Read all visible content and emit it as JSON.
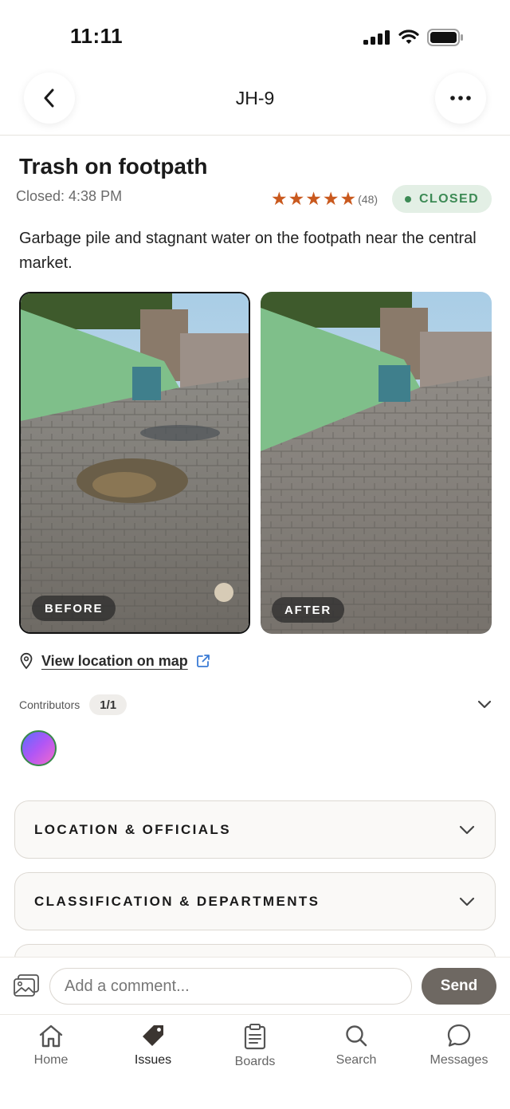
{
  "status_bar": {
    "time": "11:11"
  },
  "header": {
    "title": "JH-9",
    "back_icon": "chevron-left-icon",
    "more_icon": "ellipsis-icon"
  },
  "issue": {
    "title": "Trash on footpath",
    "closed_time": "Closed: 4:38 PM",
    "rating": {
      "stars": 5,
      "count": "(48)",
      "color": "#c9591e"
    },
    "status": {
      "label": "CLOSED",
      "color": "#3d8a55",
      "background": "#e3efe5"
    },
    "description": "Garbage pile and stagnant water on the footpath near the central market."
  },
  "photos": {
    "before_label": "BEFORE",
    "after_label": "AFTER"
  },
  "location": {
    "link_text": "View location on map",
    "pin_icon": "map-pin-icon",
    "external_icon": "external-link-icon"
  },
  "contributors": {
    "label": "Contributors",
    "count": "1/1"
  },
  "sections": [
    {
      "label": "LOCATION & OFFICIALS"
    },
    {
      "label": "CLASSIFICATION & DEPARTMENTS"
    }
  ],
  "comment": {
    "placeholder": "Add a comment...",
    "send_label": "Send"
  },
  "nav": {
    "items": [
      {
        "label": "Home",
        "icon": "home-icon"
      },
      {
        "label": "Issues",
        "icon": "tag-icon",
        "active": true
      },
      {
        "label": "Boards",
        "icon": "clipboard-icon"
      },
      {
        "label": "Search",
        "icon": "search-icon"
      },
      {
        "label": "Messages",
        "icon": "chat-bubble-icon"
      }
    ]
  }
}
